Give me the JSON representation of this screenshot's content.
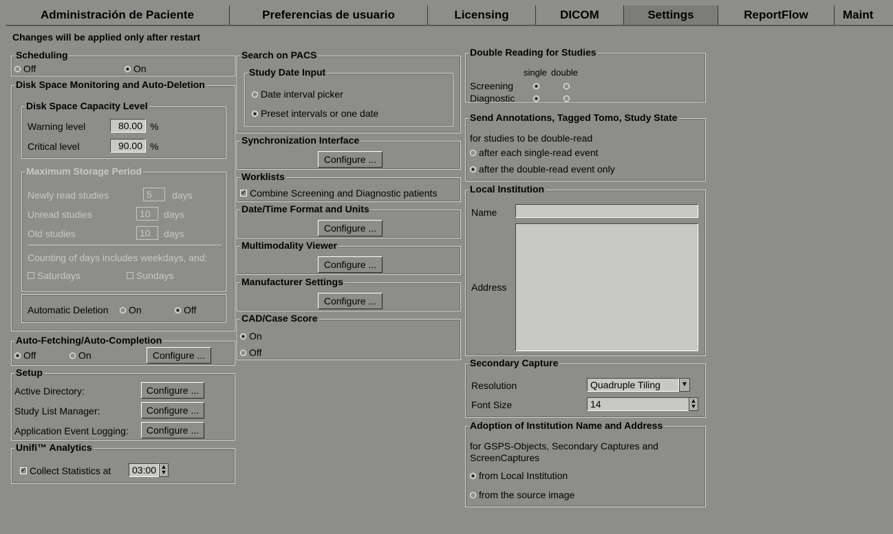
{
  "tabs": [
    "Administración de Paciente",
    "Preferencias de usuario",
    "Licensing",
    "DICOM",
    "Settings",
    "ReportFlow",
    "Maint"
  ],
  "active_tab": "Settings",
  "notice": "Changes will be applied only after restart",
  "scheduling": {
    "title": "Scheduling",
    "off": "Off",
    "on": "On",
    "selected": "On"
  },
  "disk": {
    "title": "Disk Space Monitoring and Auto-Deletion",
    "capacity": {
      "title": "Disk Space Capacity Level",
      "warning_label": "Warning level",
      "warning_value": "80.00",
      "warning_unit": "%",
      "critical_label": "Critical level",
      "critical_value": "90.00",
      "critical_unit": "%"
    },
    "storage": {
      "title": "Maximum Storage Period",
      "newly_label": "Newly read studies",
      "newly_value": "5",
      "unread_label": "Unread studies",
      "unread_value": "10",
      "old_label": "Old studies",
      "old_value": "10",
      "days": "days",
      "counting": "Counting of days includes weekdays, and:",
      "saturdays": "Saturdays",
      "sundays": "Sundays"
    },
    "auto_deletion": {
      "label": "Automatic Deletion",
      "on": "On",
      "off": "Off",
      "selected": "Off"
    }
  },
  "autofetch": {
    "title": "Auto-Fetching/Auto-Completion",
    "off": "Off",
    "on": "On",
    "selected": "Off",
    "configure": "Configure ..."
  },
  "setup": {
    "title": "Setup",
    "active_directory": "Active Directory:",
    "study_list": "Study List Manager:",
    "event_logging": "Application Event Logging:",
    "configure": "Configure ..."
  },
  "unifi": {
    "title": "Unifi™ Analytics",
    "collect": "Collect Statistics at",
    "time": "03:00",
    "checked": true
  },
  "pacs": {
    "title": "Search on PACS",
    "study_date": {
      "title": "Study Date Input",
      "opt1": "Date interval picker",
      "opt2": "Preset intervals or one date",
      "selected": 2
    }
  },
  "sync": {
    "title": "Synchronization Interface",
    "configure": "Configure ..."
  },
  "worklists": {
    "title": "Worklists",
    "combine": "Combine Screening and Diagnostic patients",
    "checked": true
  },
  "datetime": {
    "title": "Date/Time Format and Units",
    "configure": "Configure ..."
  },
  "multimodality": {
    "title": "Multimodality Viewer",
    "configure": "Configure ..."
  },
  "manufacturer": {
    "title": "Manufacturer Settings",
    "configure": "Configure ..."
  },
  "cad": {
    "title": "CAD/Case Score",
    "on": "On",
    "off": "Off",
    "selected": "On"
  },
  "double_reading": {
    "title": "Double Reading for Studies",
    "single": "single",
    "double": "double",
    "screening": "Screening",
    "diagnostic": "Diagnostic",
    "screening_sel": "single",
    "diagnostic_sel": "single"
  },
  "send_annotations": {
    "title": "Send Annotations, Tagged Tomo, Study State",
    "desc": "for studies to be double-read",
    "opt1": "after each single-read event",
    "opt2": "after the double-read event only",
    "selected": 2
  },
  "institution": {
    "title": "Local Institution",
    "name_label": "Name",
    "address_label": "Address",
    "name_value": "",
    "address_value": ""
  },
  "secondary": {
    "title": "Secondary Capture",
    "resolution_label": "Resolution",
    "resolution_value": "Quadruple Tiling",
    "font_label": "Font Size",
    "font_value": "14"
  },
  "adoption": {
    "title": "Adoption of Institution Name and Address",
    "desc1": "for GSPS-Objects, Secondary Captures and",
    "desc2": "ScreenCaptures",
    "opt1": "from Local Institution",
    "opt2": "from the source image",
    "selected": 1
  },
  "colors": {
    "background": "#8e8e89",
    "field": "#c8c8c4"
  }
}
